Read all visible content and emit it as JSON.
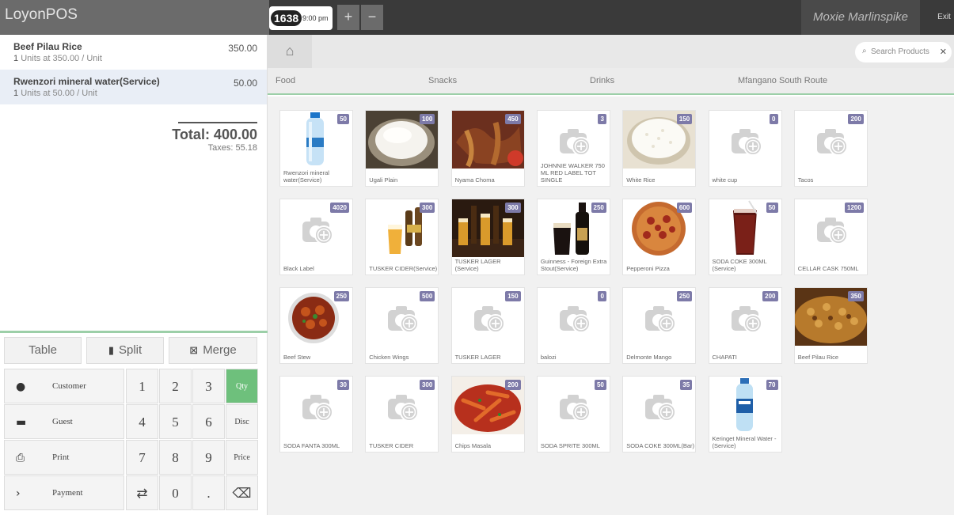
{
  "app": {
    "brand": "LoyonPOS"
  },
  "topbar": {
    "order_number": "1638",
    "order_time": "9:00 pm",
    "plus_icon": "plus-icon",
    "minus_icon": "minus-icon",
    "user": "Moxie Marlinspike",
    "exit": "Exit"
  },
  "order": {
    "lines": [
      {
        "name": "Beef Pilau Rice",
        "qty": "1",
        "detail": "Units at 350.00 / Unit",
        "price": "350.00"
      },
      {
        "name": "Rwenzori mineral water(Service)",
        "qty": "1",
        "detail": "Units at 50.00 / Unit",
        "price": "50.00"
      }
    ],
    "total": "Total: 400.00",
    "taxes": "Taxes: 55.18"
  },
  "controls": {
    "table": "Table",
    "split": "Split",
    "merge": "Merge"
  },
  "pad": {
    "customer": "Customer",
    "guest": "Guest",
    "print": "Print",
    "payment": "Payment",
    "keys": [
      "1",
      "2",
      "3",
      "Qty",
      "4",
      "5",
      "6",
      "Disc",
      "7",
      "8",
      "9",
      "Price",
      "0",
      "."
    ],
    "active_color": "#6ec07c"
  },
  "search": {
    "placeholder": "Search Products"
  },
  "categories": [
    "Food",
    "Snacks",
    "Drinks",
    "Mfangano South Route"
  ],
  "products": [
    {
      "name": "Rwenzori mineral water(Service)",
      "price": "50",
      "image": "water-bottle"
    },
    {
      "name": "Ugali Plain",
      "price": "100",
      "image": "ugali"
    },
    {
      "name": "Nyama Choma",
      "price": "450",
      "image": "meat"
    },
    {
      "name": "JOHNNIE WALKER 750 ML RED LABEL TOT SINGLE",
      "price": "3",
      "image": "placeholder"
    },
    {
      "name": "White Rice",
      "price": "150",
      "image": "rice"
    },
    {
      "name": "white cup",
      "price": "0",
      "image": "placeholder"
    },
    {
      "name": "Tacos",
      "price": "200",
      "image": "placeholder"
    },
    {
      "name": "Black Label",
      "price": "4020",
      "image": "placeholder"
    },
    {
      "name": "TUSKER CIDER(Service)",
      "price": "300",
      "image": "beer-glass"
    },
    {
      "name": "TUSKER LAGER (Service)",
      "price": "300",
      "image": "beer-bar"
    },
    {
      "name": "Guinness - Foreign Extra Stout(Service)",
      "price": "250",
      "image": "guinness"
    },
    {
      "name": "Pepperoni Pizza",
      "price": "600",
      "image": "pizza"
    },
    {
      "name": "SODA COKE 300ML (Service)",
      "price": "50",
      "image": "coke-glass"
    },
    {
      "name": "CELLAR CASK 750ML",
      "price": "1200",
      "image": "placeholder"
    },
    {
      "name": "Beef Stew",
      "price": "250",
      "image": "stew"
    },
    {
      "name": "Chicken Wings",
      "price": "500",
      "image": "placeholder"
    },
    {
      "name": "TUSKER LAGER",
      "price": "150",
      "image": "placeholder"
    },
    {
      "name": "balozi",
      "price": "0",
      "image": "placeholder"
    },
    {
      "name": "Delmonte Mango",
      "price": "250",
      "image": "placeholder"
    },
    {
      "name": "CHAPATI",
      "price": "200",
      "image": "placeholder"
    },
    {
      "name": "Beef Pilau Rice",
      "price": "350",
      "image": "pilau"
    },
    {
      "name": "SODA FANTA 300ML",
      "price": "30",
      "image": "placeholder"
    },
    {
      "name": "TUSKER CIDER",
      "price": "300",
      "image": "placeholder"
    },
    {
      "name": "Chips Masala",
      "price": "200",
      "image": "chips"
    },
    {
      "name": "SODA SPRITE 300ML",
      "price": "50",
      "image": "placeholder"
    },
    {
      "name": "SODA COKE 300ML(Bar)",
      "price": "35",
      "image": "placeholder"
    },
    {
      "name": "Keringet Mineral Water -(Service)",
      "price": "70",
      "image": "water-bottle-2"
    }
  ]
}
